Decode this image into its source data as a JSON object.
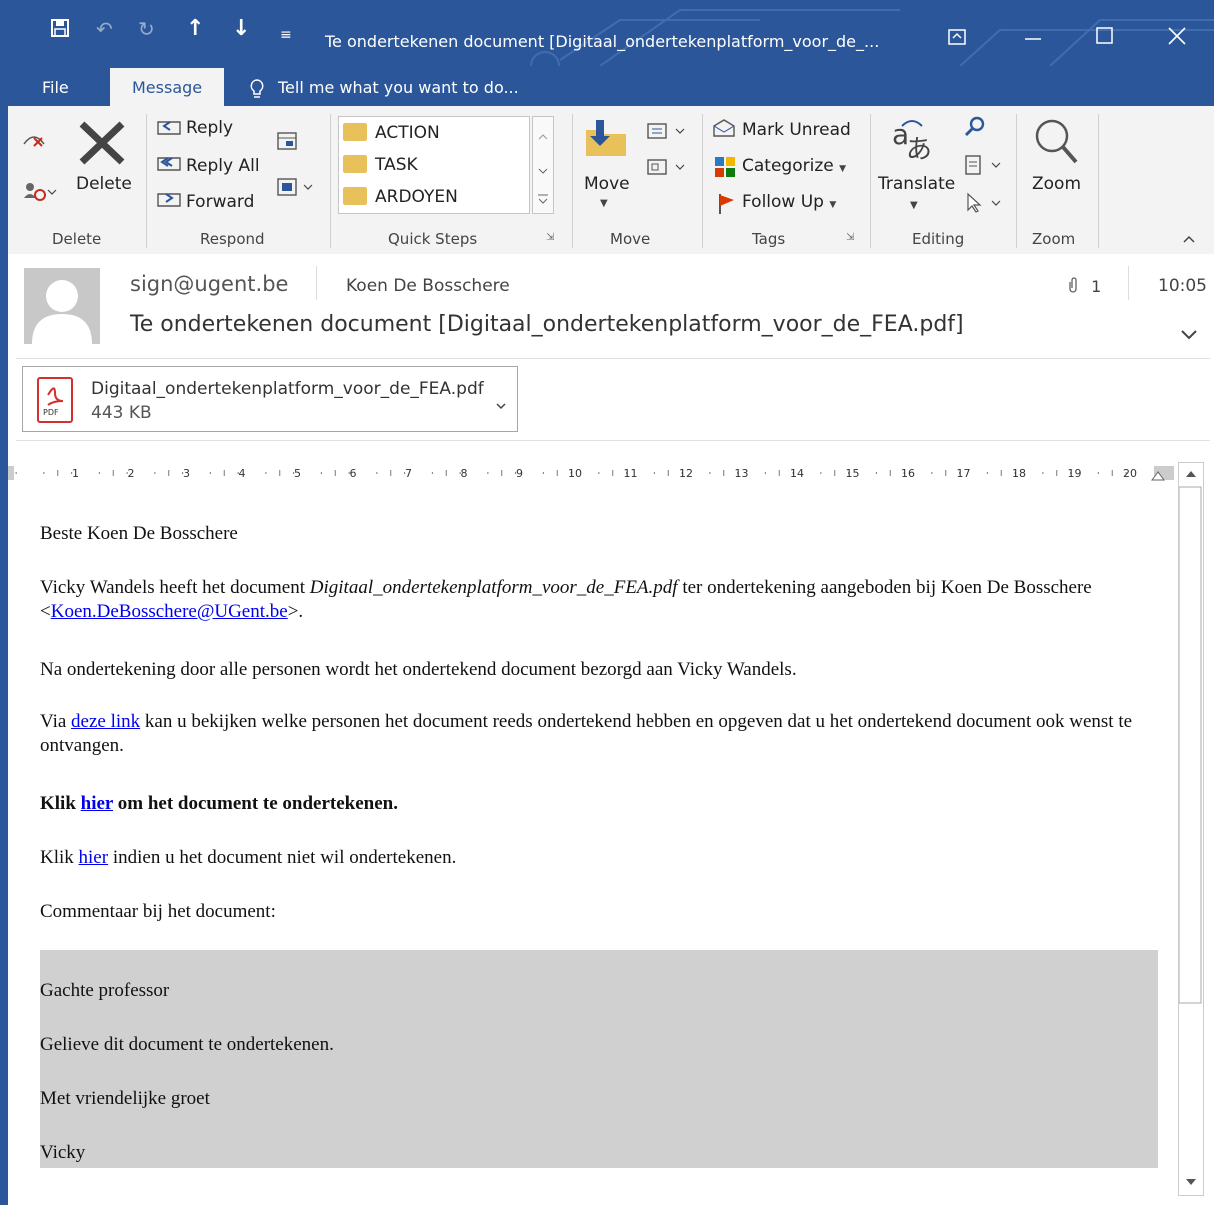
{
  "window": {
    "title": "Te ondertekenen document [Digitaal_ondertekenplatform_voor_de_...",
    "colors": {
      "accent": "#2b579a",
      "ribbon_bg": "#f3f3f3",
      "link": "#0000ee",
      "comment_bg": "#d0d0d0"
    }
  },
  "qat": {
    "save": "🖫",
    "undo": "↶",
    "redo": "↻",
    "up": "↑",
    "down": "↓",
    "more": "≡"
  },
  "tabs": {
    "file": "File",
    "message": "Message",
    "tell_me": "Tell me what you want to do..."
  },
  "ribbon": {
    "delete_group": {
      "label": "Delete",
      "delete_button": "Delete"
    },
    "respond_group": {
      "label": "Respond",
      "reply": "Reply",
      "reply_all": "Reply All",
      "forward": "Forward"
    },
    "quick_steps": {
      "label": "Quick Steps",
      "items": [
        "ACTION",
        "TASK",
        "ARDOYEN"
      ]
    },
    "move_group": {
      "label": "Move",
      "move_button": "Move"
    },
    "tags_group": {
      "label": "Tags",
      "mark_unread": "Mark Unread",
      "categorize": "Categorize",
      "follow_up": "Follow Up"
    },
    "editing_group": {
      "label": "Editing",
      "translate": "Translate"
    },
    "zoom_group": {
      "label": "Zoom",
      "zoom_button": "Zoom"
    }
  },
  "header": {
    "from": "sign@ugent.be",
    "to": "Koen De Bosschere",
    "subject": "Te ondertekenen document [Digitaal_ondertekenplatform_voor_de_FEA.pdf]",
    "attachment_count": "1",
    "time": "10:05"
  },
  "attachment": {
    "name": "Digitaal_ondertekenplatform_voor_de_FEA.pdf",
    "size": "443 KB",
    "icon_text": "PDF"
  },
  "ruler": {
    "marks": [
      "1",
      "2",
      "3",
      "4",
      "5",
      "6",
      "7",
      "8",
      "9",
      "10",
      "11",
      "12",
      "13",
      "14",
      "15",
      "16",
      "17",
      "18",
      "19",
      "20"
    ]
  },
  "body": {
    "greeting": "Beste Koen De Bosschere",
    "p1_pre": "Vicky Wandels heeft het document ",
    "p1_doc": "Digitaal_ondertekenplatform_voor_de_FEA.pdf",
    "p1_mid": " ter ondertekening aangeboden bij Koen De Bosschere <",
    "p1_email": "Koen.DeBosschere@UGent.be",
    "p1_end": ">.",
    "p2": "Na ondertekening door alle personen wordt het ondertekend document bezorgd aan Vicky Wandels.",
    "p3_pre": "Via ",
    "p3_link": "deze link",
    "p3_post": " kan u bekijken welke personen het document reeds ondertekend hebben en opgeven dat u het ondertekend document ook wenst te ontvangen.",
    "p4_pre": "Klik ",
    "p4_link": "hier",
    "p4_post": " om het document te ondertekenen.",
    "p5_pre": "Klik ",
    "p5_link": "hier",
    "p5_post": " indien u het document niet wil ondertekenen.",
    "p6": "Commentaar bij het document:"
  },
  "comment": {
    "line1": "Gachte professor",
    "line2": "Gelieve dit document te ondertekenen.",
    "line3": "Met vriendelijke groet",
    "line4": "Vicky"
  }
}
